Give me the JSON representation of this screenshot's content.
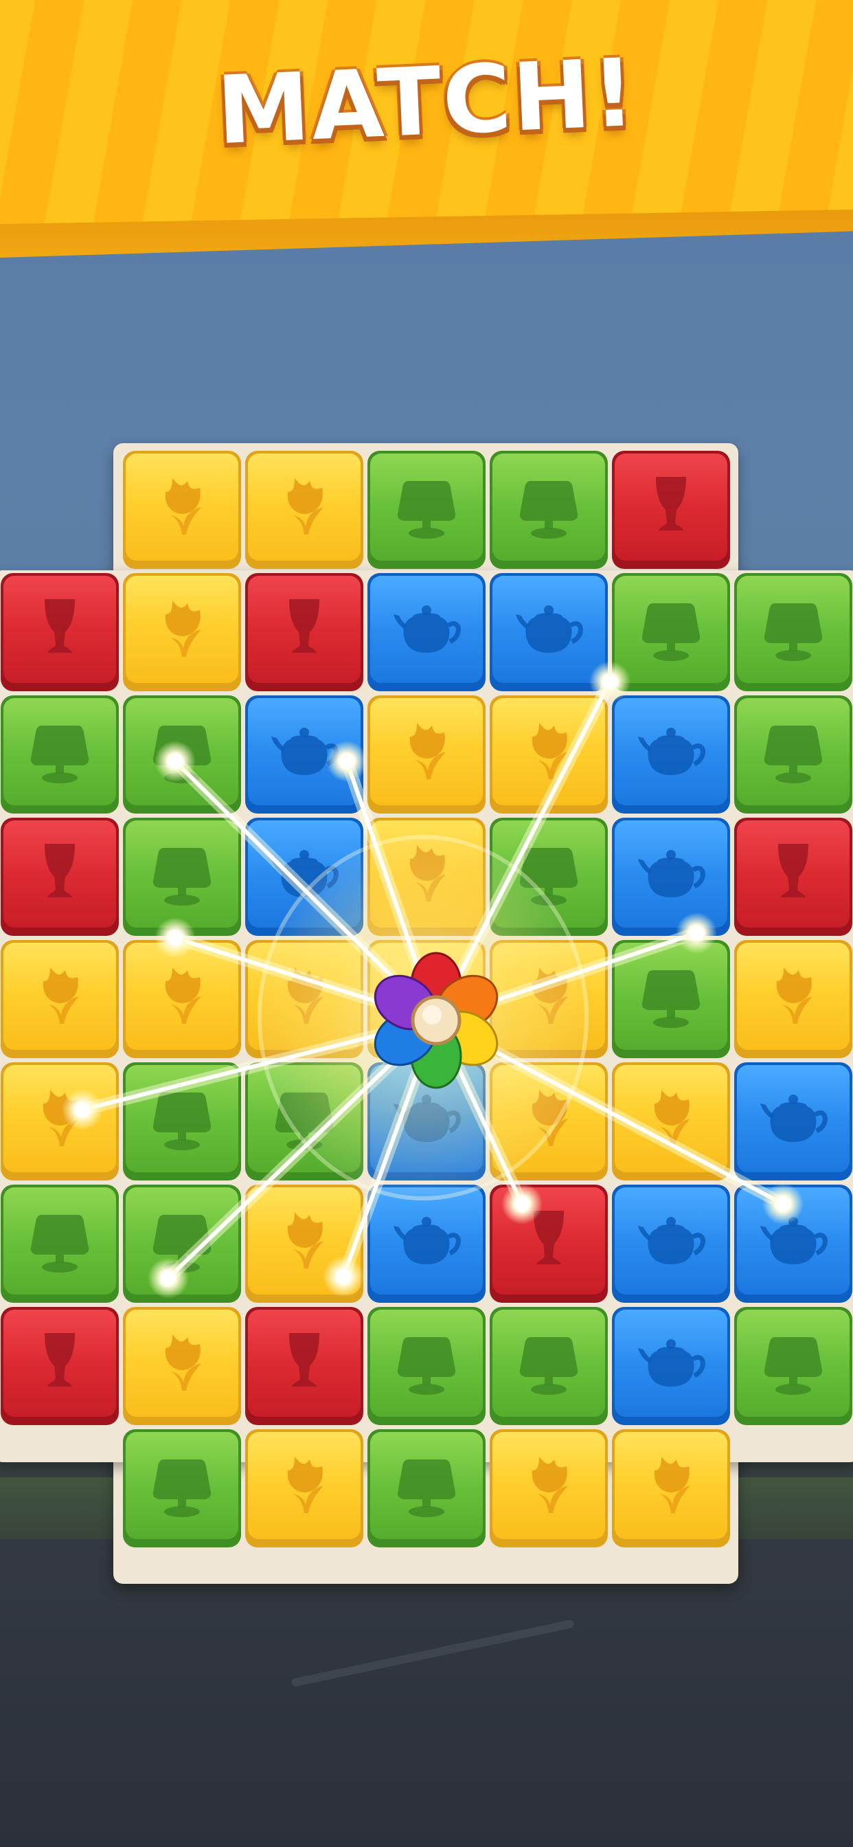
{
  "banner": {
    "title": "MATCH!"
  },
  "colors": {
    "banner": "#ffc41a",
    "yellow": "#ffcf2e",
    "green": "#68c03a",
    "blue": "#2a8cf0",
    "red": "#dc2a32",
    "frame": "#efe6d6"
  },
  "tile_icons": {
    "Y": "tulip-icon",
    "G": "lamp-icon",
    "B": "teapot-icon",
    "R": "vase-icon"
  },
  "board": {
    "rows": [
      [
        "",
        "Y",
        "Y",
        "G",
        "G",
        "R",
        ""
      ],
      [
        "R",
        "Y",
        "R",
        "B",
        "B",
        "G",
        "G"
      ],
      [
        "G",
        "G",
        "B",
        "Y",
        "Y",
        "B",
        "G"
      ],
      [
        "R",
        "G",
        "B",
        "Y",
        "G",
        "B",
        "R"
      ],
      [
        "Y",
        "Y",
        "Y",
        "Y",
        "Y",
        "G",
        "Y"
      ],
      [
        "Y",
        "G",
        "G",
        "B",
        "Y",
        "Y",
        "B"
      ],
      [
        "G",
        "G",
        "Y",
        "B",
        "R",
        "B",
        "B"
      ],
      [
        "R",
        "Y",
        "R",
        "G",
        "G",
        "B",
        "G"
      ],
      [
        "",
        "G",
        "Y",
        "G",
        "Y",
        "Y",
        ""
      ]
    ]
  },
  "booster": {
    "icon": "rainbow-flower-icon"
  }
}
